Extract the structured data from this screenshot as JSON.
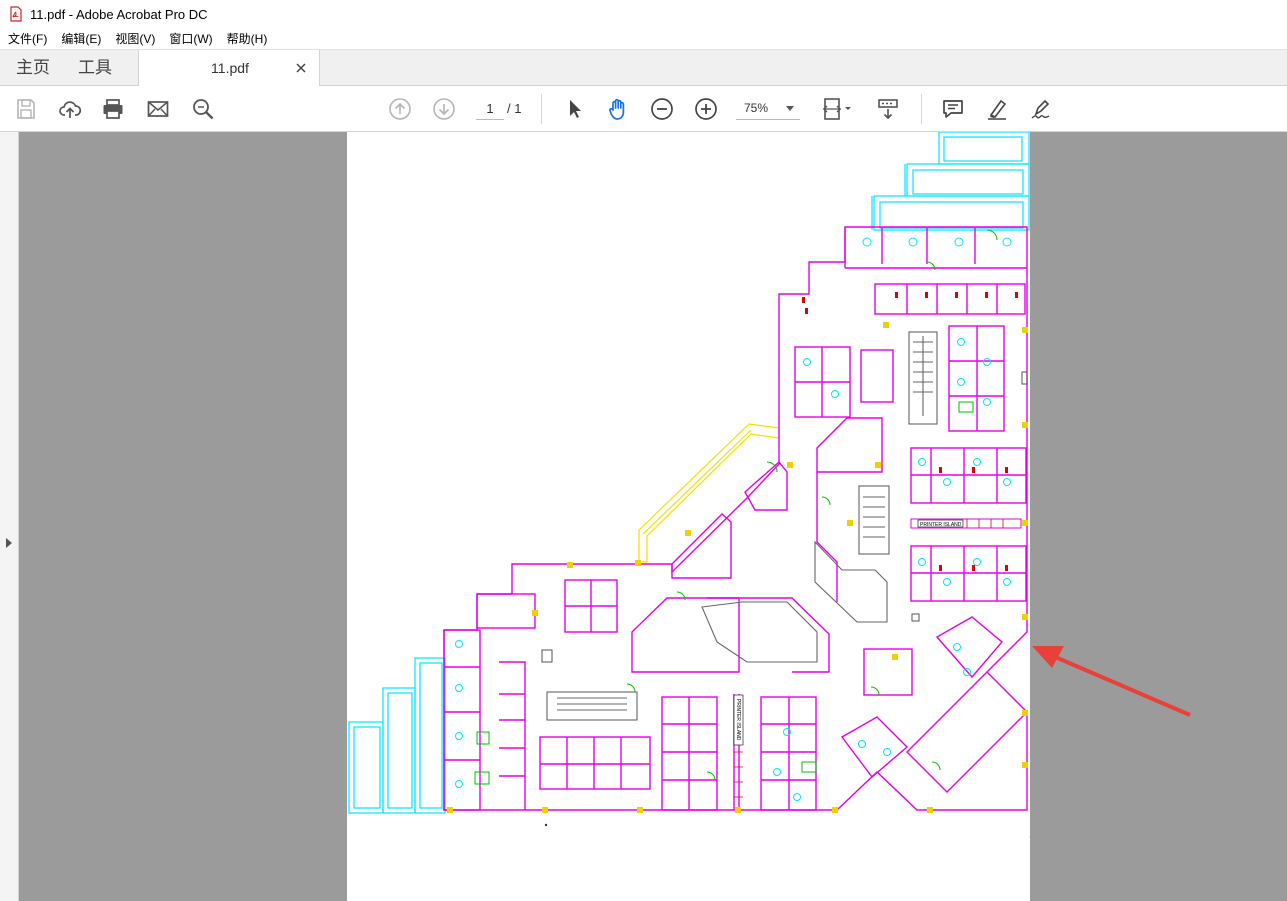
{
  "window": {
    "title": "11.pdf - Adobe Acrobat Pro DC"
  },
  "menu": {
    "items": [
      "文件(F)",
      "编辑(E)",
      "视图(V)",
      "窗口(W)",
      "帮助(H)"
    ]
  },
  "tabs": {
    "home": "主页",
    "tools": "工具",
    "document": "11.pdf"
  },
  "toolbar": {
    "page_current": "1",
    "page_total": "/ 1",
    "zoom": "75%",
    "icons": [
      "save-icon",
      "upload-cloud-icon",
      "print-icon",
      "email-icon",
      "find-icon",
      "page-up-icon",
      "page-down-icon",
      "select-arrow-icon",
      "hand-tool-icon",
      "zoom-out-icon",
      "zoom-in-icon",
      "fit-page-icon",
      "scroll-mode-icon",
      "comment-icon",
      "highlight-pen-icon",
      "sign-icon"
    ]
  },
  "floorplan": {
    "labels": {
      "printer_island_1": "PRINTER ISLAND",
      "printer_island_2": "PRINTER ISLAND"
    }
  },
  "colors": {
    "accent": "#1473e6",
    "annotation": "#e8413a",
    "cyan": "#00e5ff",
    "magenta": "#e600e6",
    "yellow": "#f0e000",
    "green": "#00c000",
    "gray": "#666666"
  }
}
